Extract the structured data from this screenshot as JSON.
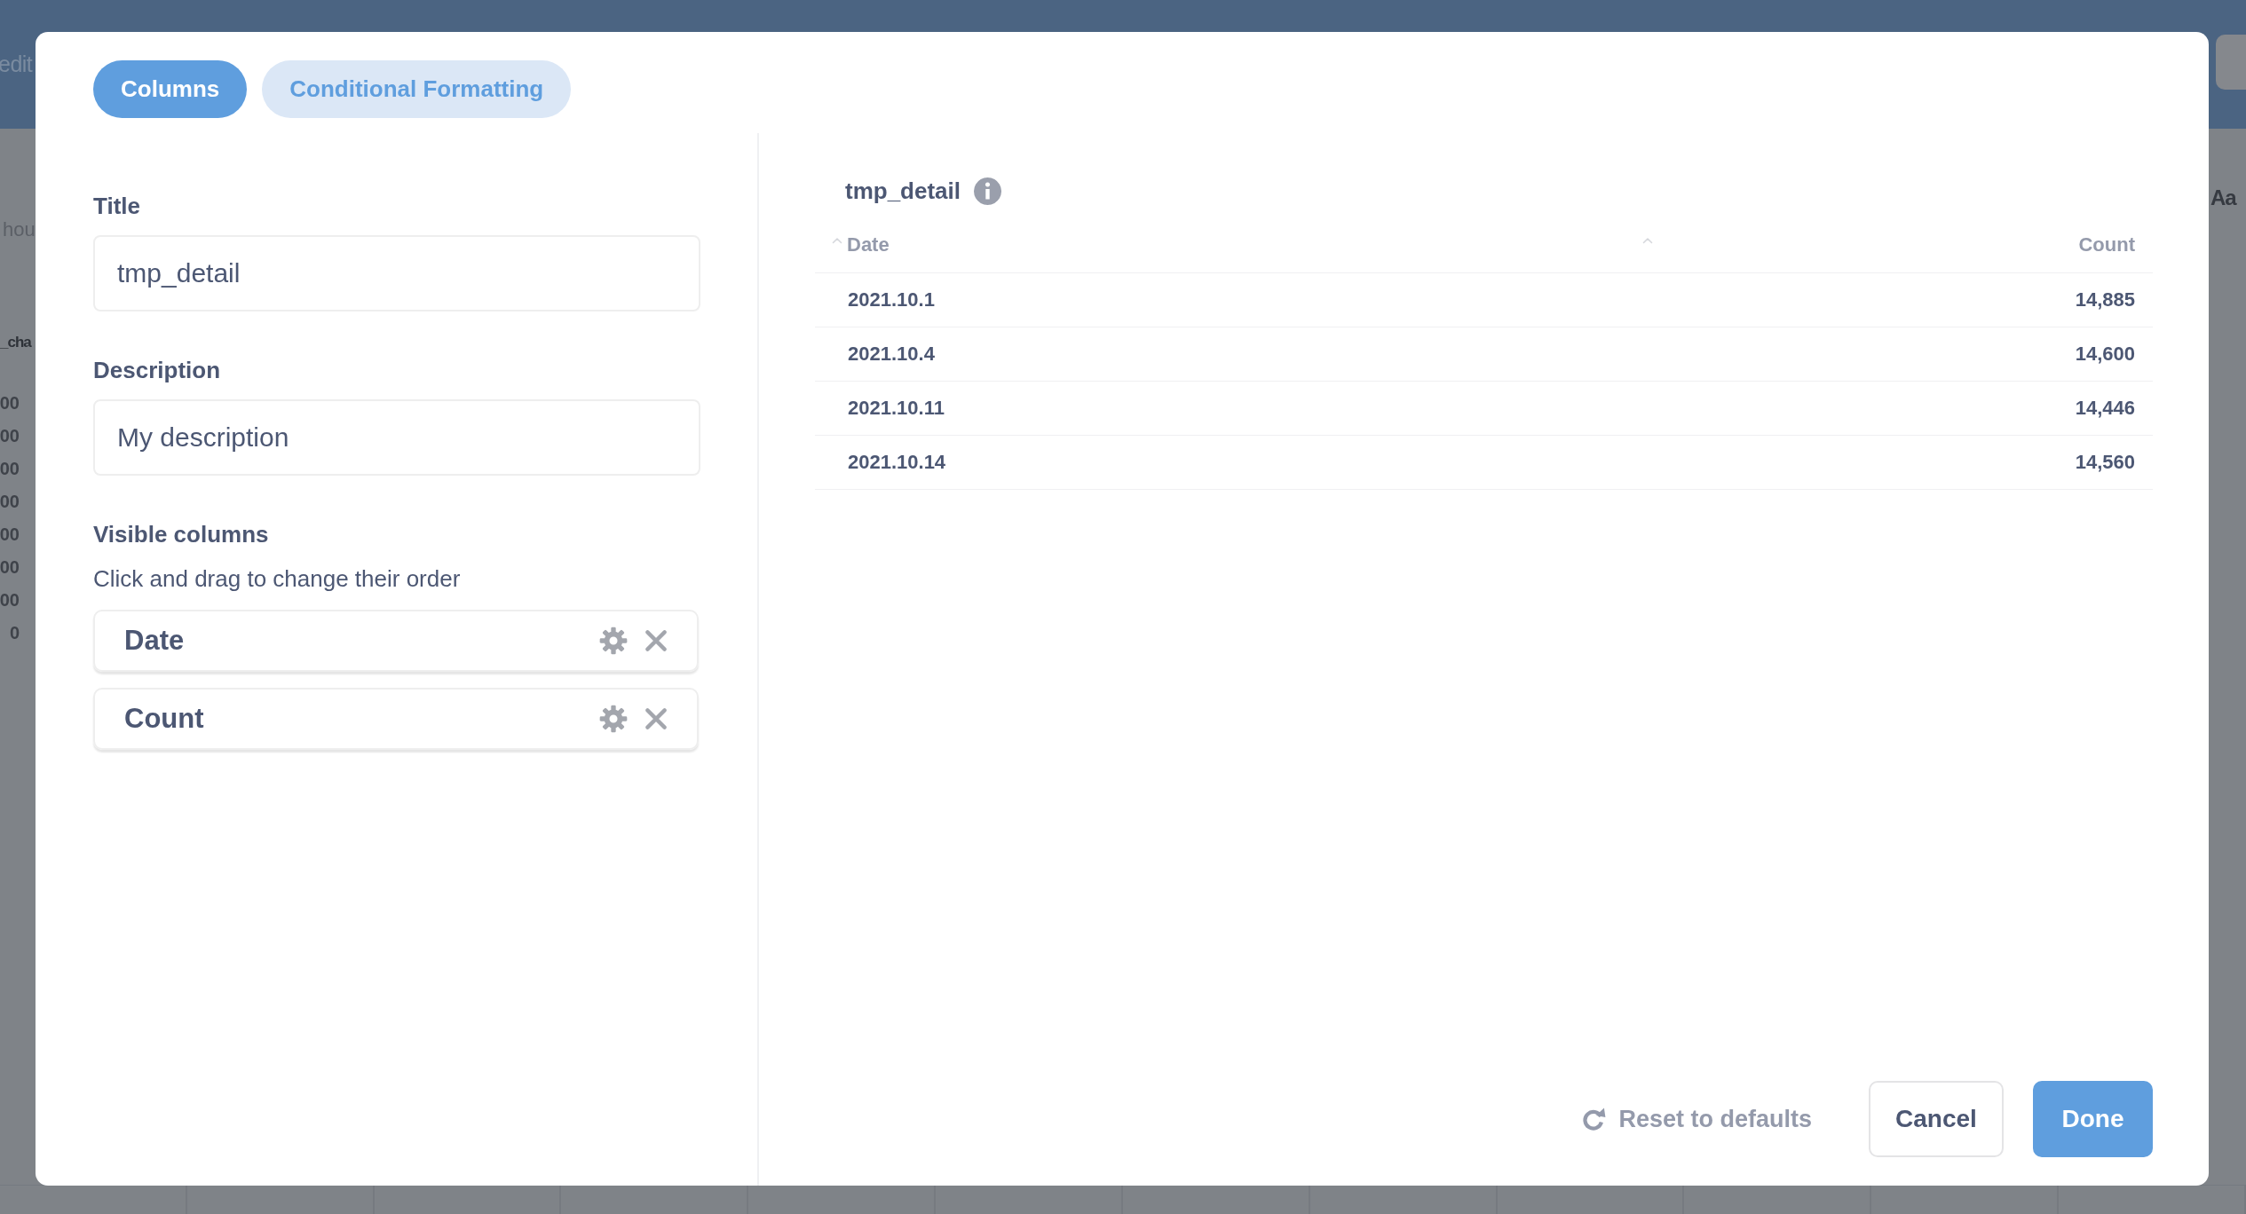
{
  "background": {
    "toolbar_text": "edit",
    "sidebar_texts": [
      "hou",
      "_cha"
    ],
    "axis_labels": [
      "00",
      "00",
      "00",
      "00",
      "00",
      "00",
      "00",
      "0"
    ],
    "side_text": "Aa"
  },
  "modal": {
    "tabs": [
      {
        "label": "Columns",
        "selected": true
      },
      {
        "label": "Conditional Formatting",
        "selected": false
      }
    ],
    "title_field": {
      "label": "Title",
      "value": "tmp_detail"
    },
    "description_field": {
      "label": "Description",
      "value": "My description"
    },
    "visible_columns": {
      "heading": "Visible columns",
      "hint": "Click and drag to change their order",
      "items": [
        {
          "name": "Date"
        },
        {
          "name": "Count"
        }
      ]
    },
    "preview": {
      "title": "tmp_detail",
      "columns": [
        {
          "label": "Date",
          "kind": "text"
        },
        {
          "label": "Count",
          "kind": "number"
        }
      ],
      "rows": [
        [
          "2021.10.1",
          "14,885"
        ],
        [
          "2021.10.4",
          "14,600"
        ],
        [
          "2021.10.11",
          "14,446"
        ],
        [
          "2021.10.14",
          "14,560"
        ]
      ]
    },
    "footer": {
      "reset_label": "Reset to defaults",
      "buttons": [
        {
          "label": "Cancel",
          "kind": "secondary"
        },
        {
          "label": "Done",
          "kind": "primary"
        }
      ]
    }
  }
}
